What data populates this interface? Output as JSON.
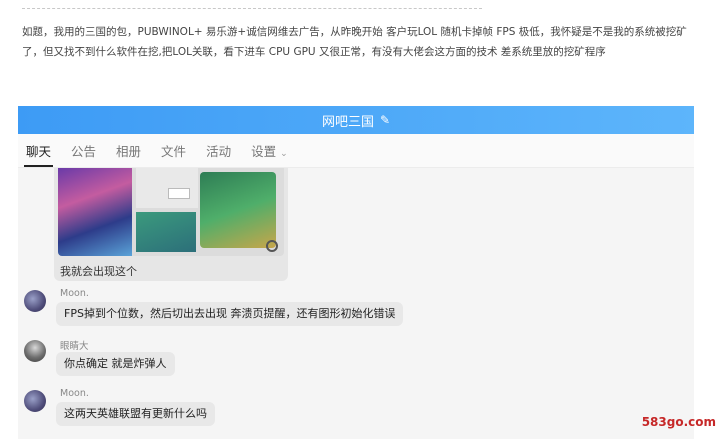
{
  "post": {
    "text": "如题，我用的三国的包，PUBWINOL+ 易乐游+诚信网维去广告，从昨晚开始  客户玩LOL 随机卡掉帧 FPS 极低，我怀疑是不是我的系统被挖矿了，但又找不到什么软件在挖,把LOL关联，看下进车 CPU  GPU 又很正常，有没有大佬会这方面的技术 差系统里放的挖矿程序"
  },
  "group": {
    "title": "网吧三国",
    "edit_icon": "pencil-icon"
  },
  "tabs": [
    {
      "label": "聊天",
      "active": true
    },
    {
      "label": "公告",
      "active": false
    },
    {
      "label": "相册",
      "active": false
    },
    {
      "label": "文件",
      "active": false
    },
    {
      "label": "活动",
      "active": false
    },
    {
      "label": "设置",
      "active": false,
      "has_dropdown": true
    }
  ],
  "messages": {
    "image_caption": "我就会出现这个",
    "m1": {
      "sender": "Moon.",
      "text": "FPS掉到个位数，然后切出去出现 奔溃页提醒，还有图形初始化错误"
    },
    "m2": {
      "sender": "眼睛大",
      "text": "你点确定 就是炸弹人"
    },
    "m3": {
      "sender": "Moon.",
      "text": "这两天英雄联盟有更新什么吗"
    }
  },
  "watermark": "583go.com"
}
